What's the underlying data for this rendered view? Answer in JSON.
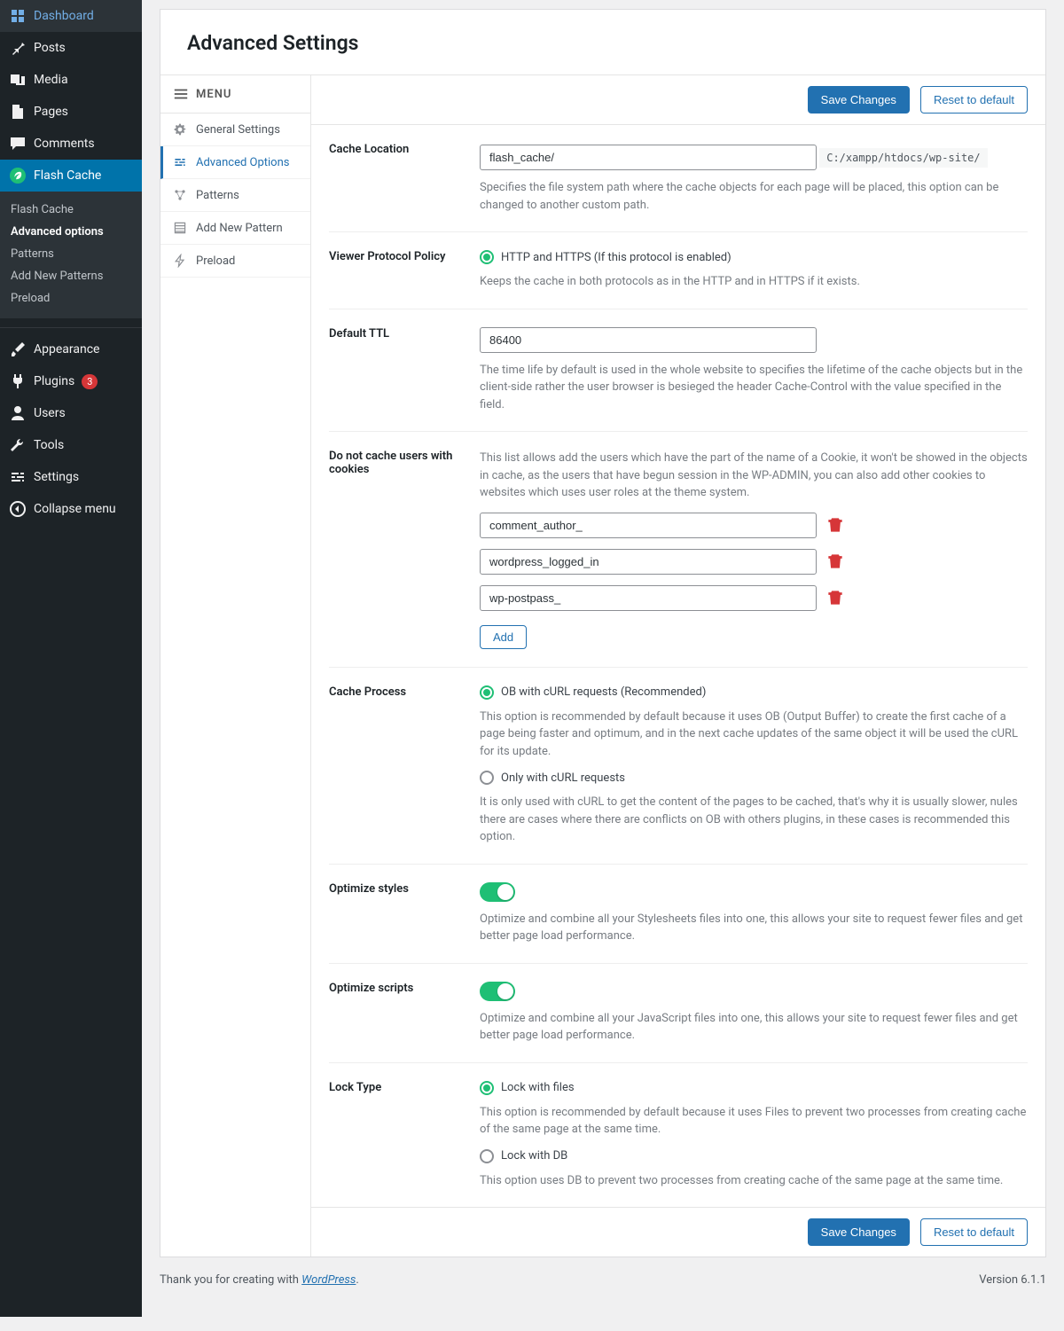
{
  "sidebar": {
    "items": [
      {
        "label": "Dashboard",
        "icon": "dashboard"
      },
      {
        "label": "Posts",
        "icon": "pin"
      },
      {
        "label": "Media",
        "icon": "media"
      },
      {
        "label": "Pages",
        "icon": "page"
      },
      {
        "label": "Comments",
        "icon": "comment"
      },
      {
        "label": "Flash Cache",
        "icon": "flash",
        "active": true
      }
    ],
    "sub": [
      {
        "label": "Flash Cache"
      },
      {
        "label": "Advanced options",
        "active": true
      },
      {
        "label": "Patterns"
      },
      {
        "label": "Add New Patterns"
      },
      {
        "label": "Preload"
      }
    ],
    "items2": [
      {
        "label": "Appearance",
        "icon": "brush"
      },
      {
        "label": "Plugins",
        "icon": "plug",
        "badge": "3"
      },
      {
        "label": "Users",
        "icon": "user"
      },
      {
        "label": "Tools",
        "icon": "wrench"
      },
      {
        "label": "Settings",
        "icon": "sliders"
      },
      {
        "label": "Collapse menu",
        "icon": "collapse"
      }
    ]
  },
  "page_title": "Advanced Settings",
  "menu": {
    "header": "MENU",
    "items": [
      {
        "label": "General Settings",
        "icon": "gear"
      },
      {
        "label": "Advanced Options",
        "icon": "sliders",
        "active": true
      },
      {
        "label": "Patterns",
        "icon": "nodes"
      },
      {
        "label": "Add New Pattern",
        "icon": "list"
      },
      {
        "label": "Preload",
        "icon": "bolt"
      }
    ]
  },
  "buttons": {
    "save": "Save Changes",
    "reset": "Reset to default",
    "add": "Add"
  },
  "fields": {
    "cache_location": {
      "label": "Cache Location",
      "value": "flash_cache/",
      "path": "C:/xampp/htdocs/wp-site/",
      "help": "Specifies the file system path where the cache objects for each page will be placed, this option can be changed to another custom path."
    },
    "viewer_protocol": {
      "label": "Viewer Protocol Policy",
      "option": "HTTP and HTTPS (If this protocol is enabled)",
      "help": "Keeps the cache in both protocols as in the HTTP and in HTTPS if it exists."
    },
    "default_ttl": {
      "label": "Default TTL",
      "value": "86400",
      "help": "The time life by default is used in the whole website to specifies the lifetime of the cache objects but in the client-side rather the user browser is besieged the header Cache-Control with the value specified in the field."
    },
    "cookies": {
      "label": "Do not cache users with cookies",
      "help": "This list allows add the users which have the part of the name of a Cookie, it won't be showed in the objects in cache, as the users that have begun session in the WP-ADMIN, you can also add other cookies to websites which uses user roles at the theme system.",
      "list": [
        "comment_author_",
        "wordpress_logged_in",
        "wp-postpass_"
      ]
    },
    "cache_process": {
      "label": "Cache Process",
      "opt1": "OB with cURL requests (Recommended)",
      "help1": "This option is recommended by default because it uses OB (Output Buffer) to create the first cache of a page being faster and optimum, and in the next cache updates of the same object it will be used the cURL for its update.",
      "opt2": "Only with cURL requests",
      "help2": "It is only used with cURL to get the content of the pages to be cached, that's why it is usually slower, nules there are cases where there are conflicts on OB with others plugins, in these cases is recommended this option."
    },
    "optimize_styles": {
      "label": "Optimize styles",
      "help": "Optimize and combine all your Stylesheets files into one, this allows your site to request fewer files and get better page load performance."
    },
    "optimize_scripts": {
      "label": "Optimize scripts",
      "help": "Optimize and combine all your JavaScript files into one, this allows your site to request fewer files and get better page load performance."
    },
    "lock_type": {
      "label": "Lock Type",
      "opt1": "Lock with files",
      "help1": "This option is recommended by default because it uses Files to prevent two processes from creating cache of the same page at the same time.",
      "opt2": "Lock with DB",
      "help2": "This option uses DB to prevent two processes from creating cache of the same page at the same time."
    }
  },
  "footer": {
    "thanks_pre": "Thank you for creating with ",
    "thanks_link": "WordPress",
    "thanks_post": ".",
    "version": "Version 6.1.1"
  }
}
